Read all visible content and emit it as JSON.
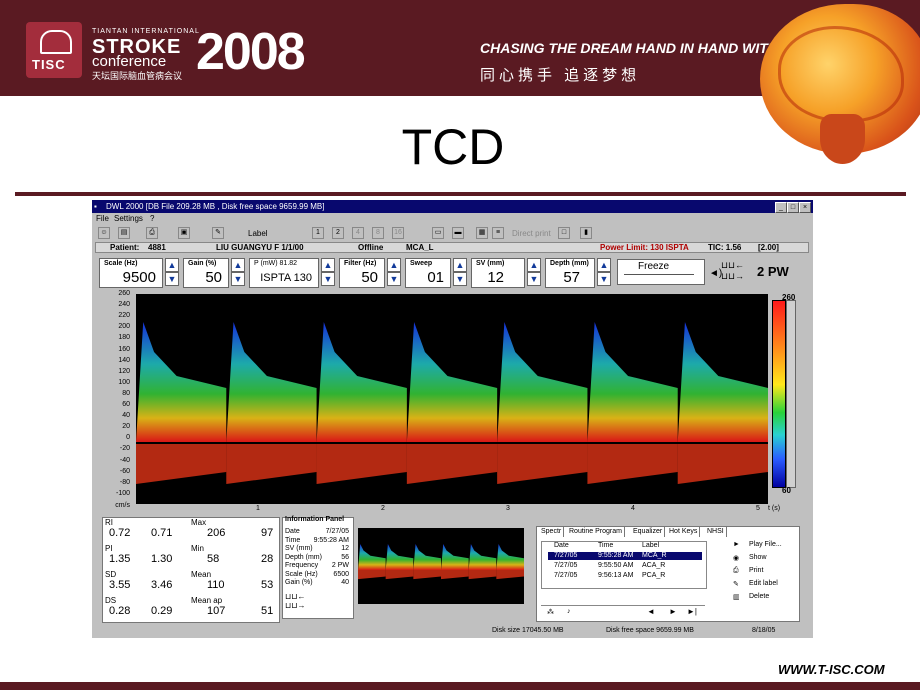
{
  "header": {
    "logo_text": "TISC",
    "conf_small": "TIANTAN INTERNATIONAL",
    "conf_stroke": "STROKE",
    "conf_conference": "conference",
    "conf_cn": "天坛国际脑血管病会议",
    "year": "2008",
    "slogan": "CHASING THE DREAM HAND IN HAND WITH ONE HEART",
    "slogan_cn": "同心携手    追逐梦想"
  },
  "slide_title": "TCD",
  "footer_url": "WWW.T-ISC.COM",
  "app": {
    "title": "DWL 2000  [DB File 209.28 MB , Disk free space 9659.99 MB]",
    "menu": [
      "File",
      "Settings",
      "?"
    ],
    "toolbar_label": "Label",
    "toolbar_numbers": [
      "1",
      "2",
      "4",
      "8",
      "16"
    ],
    "toolbar_direct": "Direct print",
    "patient": {
      "label": "Patient:",
      "id": "4881",
      "name": "LIU GUANGYU  F 1/1/00",
      "mode": "Offline",
      "vessel": "MCA_L",
      "power": "Power Limit: 130 ISPTA",
      "tic": "TIC: 1.56",
      "bracket": "[2.00]"
    },
    "params": [
      {
        "label": "Scale (Hz)",
        "value": "9500"
      },
      {
        "label": "Gain (%)",
        "value": "50"
      },
      {
        "label": "P (mW)  81.82",
        "value": "ISPTA 130"
      },
      {
        "label": "Filter (Hz)",
        "value": "50"
      },
      {
        "label": "Sweep",
        "value": "01"
      },
      {
        "label": "SV (mm)",
        "value": "12"
      },
      {
        "label": "Depth (mm)",
        "value": "57"
      }
    ],
    "freeze_label": "Freeze",
    "mode_label": "2 PW",
    "y_ticks": [
      "260",
      "240",
      "220",
      "200",
      "180",
      "160",
      "140",
      "120",
      "100",
      "80",
      "60",
      "40",
      "20",
      "0",
      "-20",
      "-40",
      "-60",
      "-80",
      "-100"
    ],
    "y_unit": "cm/s",
    "x_ticks": [
      "1",
      "2",
      "3",
      "4",
      "5"
    ],
    "x_unit": "t (s)",
    "colorbar_top": "260",
    "colorbar_bottom": "60",
    "indices": [
      {
        "name": "RI",
        "v1": "0.72",
        "v2": "0.71"
      },
      {
        "name": "PI",
        "v1": "1.35",
        "v2": "1.30"
      },
      {
        "name": "SD",
        "v1": "3.55",
        "v2": "3.46"
      },
      {
        "name": "DS",
        "v1": "0.28",
        "v2": "0.29"
      }
    ],
    "velocities": [
      {
        "name": "Max",
        "v1": "206",
        "v2": "97"
      },
      {
        "name": "Min",
        "v1": "58",
        "v2": "28"
      },
      {
        "name": "Mean",
        "v1": "110",
        "v2": "53"
      },
      {
        "name": "Mean ap",
        "v1": "107",
        "v2": "51"
      }
    ],
    "info_title": "Information Panel",
    "info": [
      {
        "k": "Date",
        "v": "7/27/05"
      },
      {
        "k": "Time",
        "v": "9:55:28 AM"
      },
      {
        "k": "SV (mm)",
        "v": "12"
      },
      {
        "k": "Depth (mm)",
        "v": "56"
      },
      {
        "k": "Frequency",
        "v": "2   PW"
      },
      {
        "k": "Scale (Hz)",
        "v": "6500"
      },
      {
        "k": "Gain (%)",
        "v": "40"
      }
    ],
    "tabs": [
      "Spectr",
      "Routine Program",
      "Equalizer",
      "Hot Keys",
      "NHSI"
    ],
    "table_headers": [
      "Date",
      "Time",
      "Label"
    ],
    "table_rows": [
      [
        "7/27/05",
        "9:55:28 AM",
        "MCA_R"
      ],
      [
        "7/27/05",
        "9:55:50 AM",
        "ACA_R"
      ],
      [
        "7/27/05",
        "9:56:13 AM",
        "PCA_R"
      ]
    ],
    "actions": [
      "Play File...",
      "Show",
      "Print",
      "Edit label",
      "Delete"
    ],
    "status": {
      "disk_size": "Disk size 17045.50 MB",
      "disk_free": "Disk free space 9659.99 MB",
      "date": "8/18/05"
    }
  }
}
